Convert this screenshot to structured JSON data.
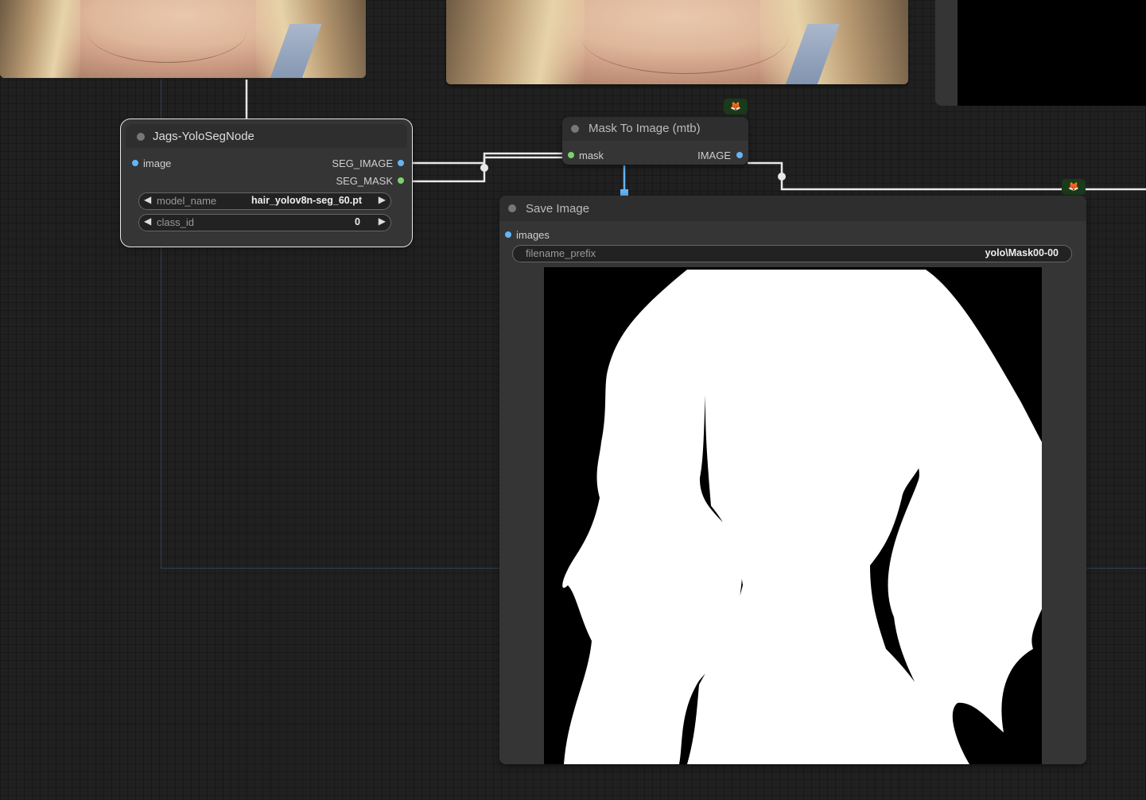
{
  "nodes": {
    "yolo": {
      "title": "Jags-YoloSegNode",
      "input_image": "image",
      "output_seg_image": "SEG_IMAGE",
      "output_seg_mask": "SEG_MASK",
      "model_name_label": "model_name",
      "model_name_value": "hair_yolov8n-seg_60.pt",
      "class_id_label": "class_id",
      "class_id_value": "0"
    },
    "mask_to_image": {
      "title": "Mask To Image (mtb)",
      "input_mask": "mask",
      "output_image": "IMAGE"
    },
    "save_image": {
      "title": "Save Image",
      "input_images": "images",
      "filename_prefix_label": "filename_prefix",
      "filename_prefix_value": "yolo\\Mask00-00"
    }
  },
  "colors": {
    "canvas_bg": "#202020",
    "node_bg": "#353535",
    "link_white": "#e8e8e8",
    "pin_image": "#64b5f6",
    "pin_mask": "#7bd36b",
    "badge_icon": "#ff8a1f"
  },
  "icons": {
    "badge": "fox-icon"
  }
}
